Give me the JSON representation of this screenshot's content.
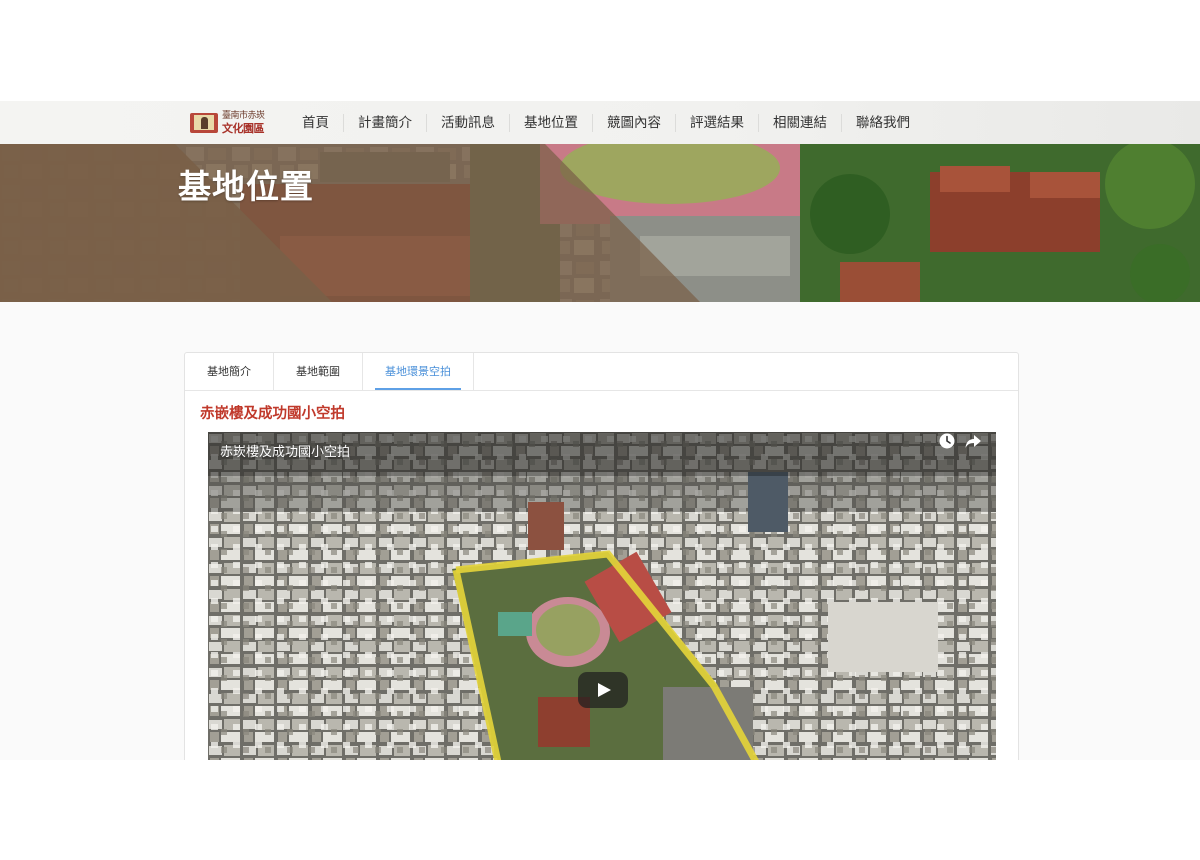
{
  "header": {
    "logo": {
      "line1": "臺南市赤崁",
      "line2": "文化園區"
    },
    "nav": [
      "首頁",
      "計畫簡介",
      "活動訊息",
      "基地位置",
      "競圖內容",
      "評選結果",
      "相關連結",
      "聯絡我們"
    ]
  },
  "banner": {
    "title": "基地位置"
  },
  "tabs": [
    "基地簡介",
    "基地範圍",
    "基地環景空拍"
  ],
  "active_tab": "基地環景空拍",
  "section": {
    "title": "赤嵌樓及成功國小空拍"
  },
  "video": {
    "title": "赤崁樓及成功國小空拍",
    "icons": [
      "clock-icon",
      "share-icon",
      "play-icon"
    ]
  },
  "colors": {
    "accent_blue": "#4a90d9",
    "title_red": "#c0392b",
    "banner_brown": "#7a5f48",
    "highlight_yellow": "#e3d23a"
  }
}
